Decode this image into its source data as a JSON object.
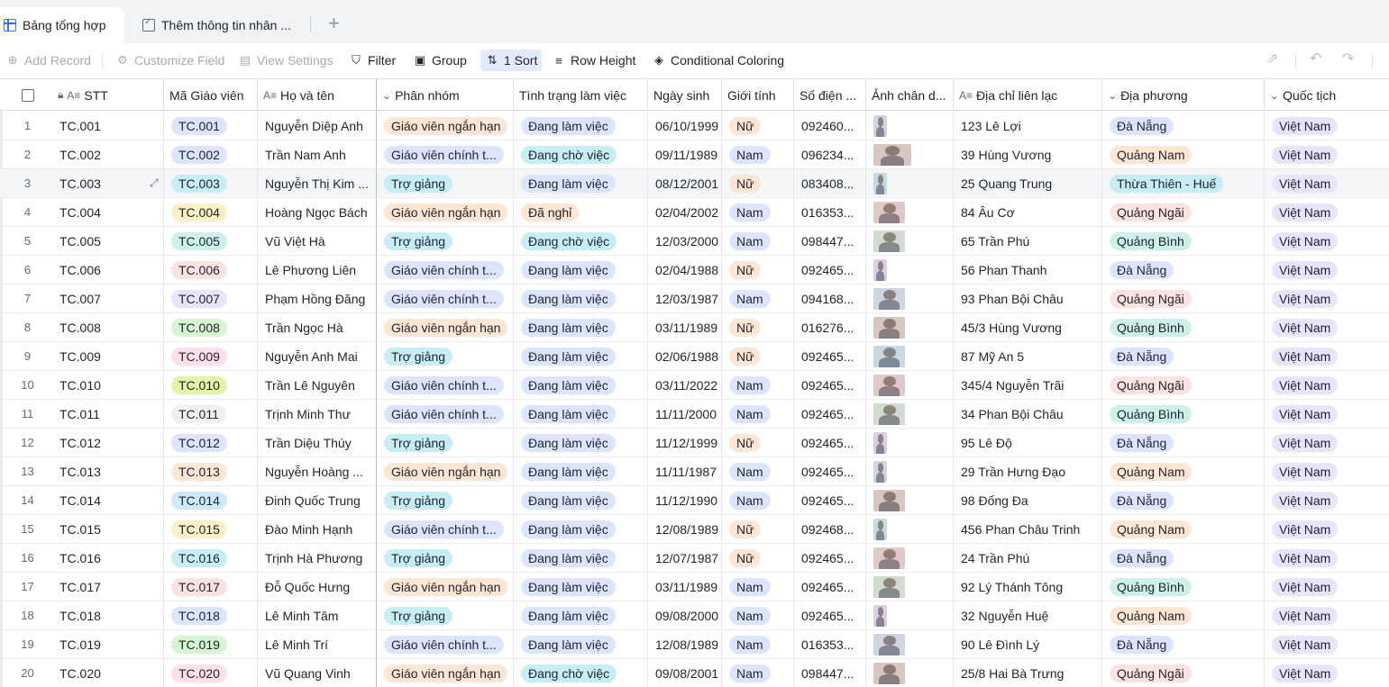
{
  "tabs": [
    {
      "label": "Bảng tổng hợp",
      "icon": "grid-icon"
    },
    {
      "label": "Thêm thông tin nhân ...",
      "icon": "form-icon"
    }
  ],
  "toolbar": {
    "add_record": "Add Record",
    "customize_field": "Customize Field",
    "view_settings": "View Settings",
    "filter": "Filter",
    "group": "Group",
    "sort": "1 Sort",
    "row_height": "Row Height",
    "conditional_coloring": "Conditional Coloring"
  },
  "columns": [
    "STT",
    "Mã Giáo viên",
    "Họ và tên",
    "Phân nhóm",
    "Tình trạng làm việc",
    "Ngày sinh",
    "Giới tính",
    "Số điện ...",
    "Ảnh chân d...",
    "Địa chỉ liên lạc",
    "Địa phương",
    "Quốc tịch"
  ],
  "colors": {
    "accent": "#3370ff",
    "ma_gv": [
      "#dbe6fe",
      "#dbe6fe",
      "#c7edf5",
      "#fdf0c7",
      "#cdf0ea",
      "#fde2e2",
      "#e7e4fb",
      "#d6f5d1",
      "#fde0ea",
      "#e3f4a6",
      "#eff0f1",
      "#dbe6fe",
      "#fde6d3",
      "#cde9fb",
      "#fdf0c7",
      "#c7edf5",
      "#fde2e2",
      "#dbe6fe",
      "#d6f5d1",
      "#fde0ea"
    ],
    "nhom": {
      "Giáo viên ngắn hạn": "#fde6d3",
      "Giáo viên chính t...": "#dbe6fe",
      "Trợ giảng": "#c7edf5"
    },
    "tinhtrang": {
      "Đang làm việc": "#dbe6fe",
      "Đang chờ việc": "#c7edf5",
      "Đã nghỉ": "#fde6d3"
    },
    "gioitinh": {
      "Nữ": "#fde6d3",
      "Nam": "#dbe6fe"
    },
    "diaphuong": {
      "Đà Nẵng": "#dbe6fe",
      "Quảng Nam": "#fde6d3",
      "Thừa Thiên - Huế": "#c7edf5",
      "Quảng Ngãi": "#fde2e2",
      "Quảng Bình": "#cdf0ea"
    },
    "quoctich": "#e7e4fb"
  },
  "rows": [
    {
      "idx": "1",
      "stt": "TC.001",
      "ma": "TC.001",
      "ten": "Nguyễn Diệp Anh",
      "nhom": "Giáo viên ngắn hạn",
      "tinhtrang": "Đang làm việc",
      "ngaysinh": "06/10/1999",
      "gioitinh": "Nữ",
      "sdt": "092460...",
      "diachi": "123 Lê Lợi",
      "diaphuong": "Đà Nẵng",
      "quoctich": "Việt Nam",
      "photo": "portrait"
    },
    {
      "idx": "2",
      "stt": "TC.002",
      "ma": "TC.002",
      "ten": "Trần Nam Anh",
      "nhom": "Giáo viên chính t...",
      "tinhtrang": "Đang chờ việc",
      "ngaysinh": "09/11/1989",
      "gioitinh": "Nam",
      "sdt": "096234...",
      "diachi": "39 Hùng Vương",
      "diaphuong": "Quảng Nam",
      "quoctich": "Việt Nam",
      "photo": "wide"
    },
    {
      "idx": "3",
      "stt": "TC.003",
      "ma": "TC.003",
      "ten": "Nguyễn Thị Kim ...",
      "nhom": "Trợ giảng",
      "tinhtrang": "Đang làm việc",
      "ngaysinh": "08/12/2001",
      "gioitinh": "Nữ",
      "sdt": "083408...",
      "diachi": "25 Quang Trung",
      "diaphuong": "Thừa Thiên - Huế",
      "quoctich": "Việt Nam",
      "photo": "portrait"
    },
    {
      "idx": "4",
      "stt": "TC.004",
      "ma": "TC.004",
      "ten": "Hoàng Ngọc Bách",
      "nhom": "Giáo viên ngắn hạn",
      "tinhtrang": "Đã nghỉ",
      "ngaysinh": "02/04/2002",
      "gioitinh": "Nam",
      "sdt": "016353...",
      "diachi": "84 Âu Cơ",
      "diaphuong": "Quảng Ngãi",
      "quoctich": "Việt Nam",
      "photo": "square"
    },
    {
      "idx": "5",
      "stt": "TC.005",
      "ma": "TC.005",
      "ten": "Vũ Việt Hà",
      "nhom": "Trợ giảng",
      "tinhtrang": "Đang chờ việc",
      "ngaysinh": "12/03/2000",
      "gioitinh": "Nam",
      "sdt": "098447...",
      "diachi": "65 Trần Phú",
      "diaphuong": "Quảng Bình",
      "quoctich": "Việt Nam",
      "photo": "square"
    },
    {
      "idx": "6",
      "stt": "TC.006",
      "ma": "TC.006",
      "ten": "Lê Phương Liên",
      "nhom": "Giáo viên chính t...",
      "tinhtrang": "Đang làm việc",
      "ngaysinh": "02/04/1988",
      "gioitinh": "Nữ",
      "sdt": "092465...",
      "diachi": "56 Phan Thanh",
      "diaphuong": "Đà Nẵng",
      "quoctich": "Việt Nam",
      "photo": "portrait"
    },
    {
      "idx": "7",
      "stt": "TC.007",
      "ma": "TC.007",
      "ten": "Phạm Hồng Đăng",
      "nhom": "Giáo viên chính t...",
      "tinhtrang": "Đang làm việc",
      "ngaysinh": "12/03/1987",
      "gioitinh": "Nam",
      "sdt": "094168...",
      "diachi": "93 Phan Bội Châu",
      "diaphuong": "Quảng Ngãi",
      "quoctich": "Việt Nam",
      "photo": "square"
    },
    {
      "idx": "8",
      "stt": "TC.008",
      "ma": "TC.008",
      "ten": "Trần Ngọc Hà",
      "nhom": "Giáo viên ngắn hạn",
      "tinhtrang": "Đang làm việc",
      "ngaysinh": "03/11/1989",
      "gioitinh": "Nữ",
      "sdt": "016276...",
      "diachi": "45/3 Hùng Vương",
      "diaphuong": "Quảng Bình",
      "quoctich": "Việt Nam",
      "photo": "square"
    },
    {
      "idx": "9",
      "stt": "TC.009",
      "ma": "TC.009",
      "ten": "Nguyễn Anh Mai",
      "nhom": "Trợ giảng",
      "tinhtrang": "Đang làm việc",
      "ngaysinh": "02/06/1988",
      "gioitinh": "Nữ",
      "sdt": "092465...",
      "diachi": "87 Mỹ An 5",
      "diaphuong": "Đà Nẵng",
      "quoctich": "Việt Nam",
      "photo": "square"
    },
    {
      "idx": "10",
      "stt": "TC.010",
      "ma": "TC.010",
      "ten": "Trần Lê Nguyên",
      "nhom": "Giáo viên chính t...",
      "tinhtrang": "Đang làm việc",
      "ngaysinh": "03/11/2022",
      "gioitinh": "Nam",
      "sdt": "092465...",
      "diachi": "345/4 Nguyễn Trãi",
      "diaphuong": "Quảng Ngãi",
      "quoctich": "Việt Nam",
      "photo": "square"
    },
    {
      "idx": "11",
      "stt": "TC.011",
      "ma": "TC.011",
      "ten": "Trịnh Minh Thư",
      "nhom": "Giáo viên chính t...",
      "tinhtrang": "Đang làm việc",
      "ngaysinh": "11/11/2000",
      "gioitinh": "Nam",
      "sdt": "092465...",
      "diachi": "34 Phan Bội Châu",
      "diaphuong": "Quảng Bình",
      "quoctich": "Việt Nam",
      "photo": "square"
    },
    {
      "idx": "12",
      "stt": "TC.012",
      "ma": "TC.012",
      "ten": "Trần Diệu Thúy",
      "nhom": "Trợ giảng",
      "tinhtrang": "Đang làm việc",
      "ngaysinh": "11/12/1999",
      "gioitinh": "Nữ",
      "sdt": "092465...",
      "diachi": "95 Lê Độ",
      "diaphuong": "Đà Nẵng",
      "quoctich": "Việt Nam",
      "photo": "portrait"
    },
    {
      "idx": "13",
      "stt": "TC.013",
      "ma": "TC.013",
      "ten": "Nguyễn Hoàng ...",
      "nhom": "Giáo viên ngắn hạn",
      "tinhtrang": "Đang làm việc",
      "ngaysinh": "11/11/1987",
      "gioitinh": "Nam",
      "sdt": "092465...",
      "diachi": "29 Trần Hưng Đạo",
      "diaphuong": "Quảng Nam",
      "quoctich": "Việt Nam",
      "photo": "portrait"
    },
    {
      "idx": "14",
      "stt": "TC.014",
      "ma": "TC.014",
      "ten": "Đinh Quốc Trung",
      "nhom": "Trợ giảng",
      "tinhtrang": "Đang làm việc",
      "ngaysinh": "11/12/1990",
      "gioitinh": "Nam",
      "sdt": "092465...",
      "diachi": "98 Đống Đa",
      "diaphuong": "Đà Nẵng",
      "quoctich": "Việt Nam",
      "photo": "square"
    },
    {
      "idx": "15",
      "stt": "TC.015",
      "ma": "TC.015",
      "ten": "Đào Minh Hạnh",
      "nhom": "Giáo viên chính t...",
      "tinhtrang": "Đang làm việc",
      "ngaysinh": "12/08/1989",
      "gioitinh": "Nữ",
      "sdt": "092468...",
      "diachi": "456 Phan Châu Trinh",
      "diaphuong": "Quảng Nam",
      "quoctich": "Việt Nam",
      "photo": "portrait"
    },
    {
      "idx": "16",
      "stt": "TC.016",
      "ma": "TC.016",
      "ten": "Trịnh Hà Phương",
      "nhom": "Trợ giảng",
      "tinhtrang": "Đang làm việc",
      "ngaysinh": "12/07/1987",
      "gioitinh": "Nữ",
      "sdt": "092465...",
      "diachi": "24 Trần Phú",
      "diaphuong": "Đà Nẵng",
      "quoctich": "Việt Nam",
      "photo": "square"
    },
    {
      "idx": "17",
      "stt": "TC.017",
      "ma": "TC.017",
      "ten": "Đỗ Quốc Hưng",
      "nhom": "Giáo viên ngắn hạn",
      "tinhtrang": "Đang làm việc",
      "ngaysinh": "03/11/1989",
      "gioitinh": "Nam",
      "sdt": "092465...",
      "diachi": "92 Lý Thánh Tông",
      "diaphuong": "Quảng Bình",
      "quoctich": "Việt Nam",
      "photo": "square"
    },
    {
      "idx": "18",
      "stt": "TC.018",
      "ma": "TC.018",
      "ten": "Lê Minh Tâm",
      "nhom": "Trợ giảng",
      "tinhtrang": "Đang làm việc",
      "ngaysinh": "09/08/2000",
      "gioitinh": "Nam",
      "sdt": "092465...",
      "diachi": "32 Nguyễn Huệ",
      "diaphuong": "Quảng Nam",
      "quoctich": "Việt Nam",
      "photo": "portrait"
    },
    {
      "idx": "19",
      "stt": "TC.019",
      "ma": "TC.019",
      "ten": "Lê Minh Trí",
      "nhom": "Giáo viên chính t...",
      "tinhtrang": "Đang làm việc",
      "ngaysinh": "12/08/1989",
      "gioitinh": "Nam",
      "sdt": "016353...",
      "diachi": "90 Lê Đình Lý",
      "diaphuong": "Đà Nẵng",
      "quoctich": "Việt Nam",
      "photo": "square"
    },
    {
      "idx": "20",
      "stt": "TC.020",
      "ma": "TC.020",
      "ten": "Vũ Quang Vinh",
      "nhom": "Giáo viên ngắn hạn",
      "tinhtrang": "Đang chờ việc",
      "ngaysinh": "09/08/2001",
      "gioitinh": "Nam",
      "sdt": "098447...",
      "diachi": "25/8 Hai Bà Trưng",
      "diaphuong": "Quảng Ngãi",
      "quoctich": "Việt Nam",
      "photo": "square"
    }
  ]
}
